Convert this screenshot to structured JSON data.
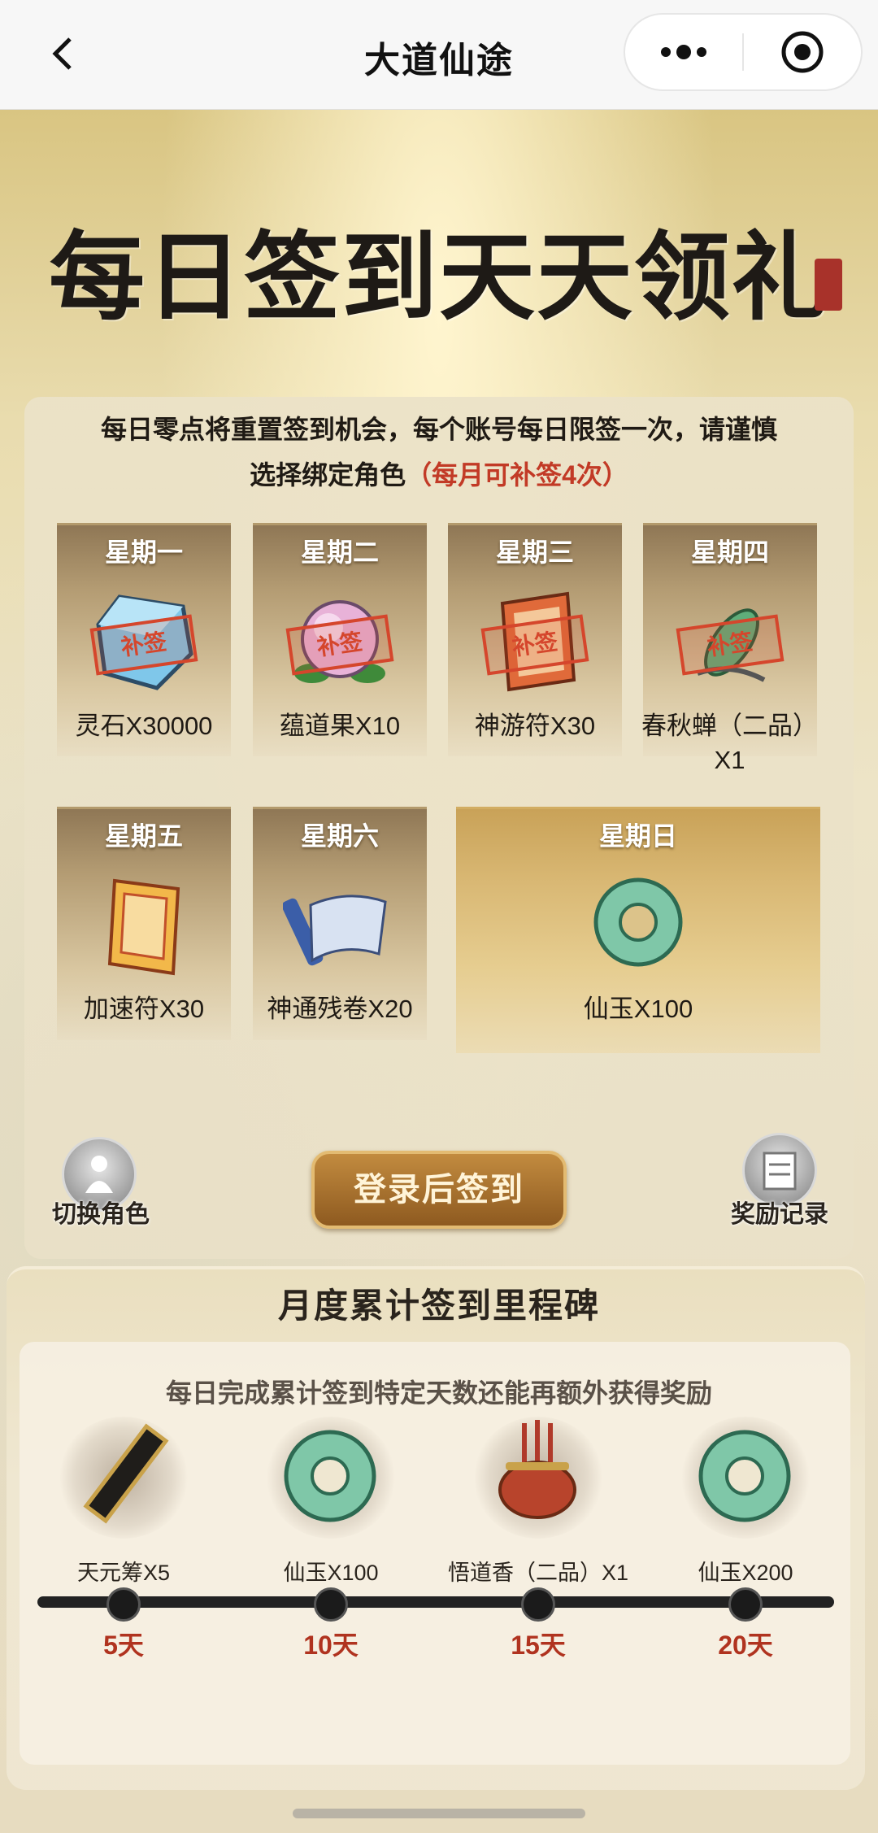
{
  "nav": {
    "title": "大道仙途"
  },
  "banner": {
    "title": "每日签到天天领礼"
  },
  "notice": {
    "line1": "每日零点将重置签到机会，每个账号每日限签一次，请谨慎",
    "line2": "选择绑定角色",
    "highlight": "（每月可补签4次）"
  },
  "days": [
    {
      "day": "星期一",
      "reward": "灵石X30000",
      "stamp": "补签"
    },
    {
      "day": "星期二",
      "reward": "蕴道果X10",
      "stamp": "补签"
    },
    {
      "day": "星期三",
      "reward": "神游符X30",
      "stamp": "补签"
    },
    {
      "day": "星期四",
      "reward": "春秋蝉（二品）X1",
      "stamp": "补签"
    },
    {
      "day": "星期五",
      "reward": "加速符X30"
    },
    {
      "day": "星期六",
      "reward": "神通残卷X20"
    },
    {
      "day": "星期日",
      "reward": "仙玉X100"
    }
  ],
  "controls": {
    "switch_role": "切换角色",
    "login_sign": "登录后签到",
    "reward_record": "奖励记录"
  },
  "milestone": {
    "title": "月度累计签到里程碑",
    "subtitle": "每日完成累计签到特定天数还能再额外获得奖励",
    "items": [
      {
        "reward": "天元筹X5",
        "days": "5天"
      },
      {
        "reward": "仙玉X100",
        "days": "10天"
      },
      {
        "reward": "悟道香（二品）X1",
        "days": "15天"
      },
      {
        "reward": "仙玉X200",
        "days": "20天"
      }
    ]
  },
  "colors": {
    "accent_red": "#c23a26",
    "button_gold": "#a8702e"
  }
}
